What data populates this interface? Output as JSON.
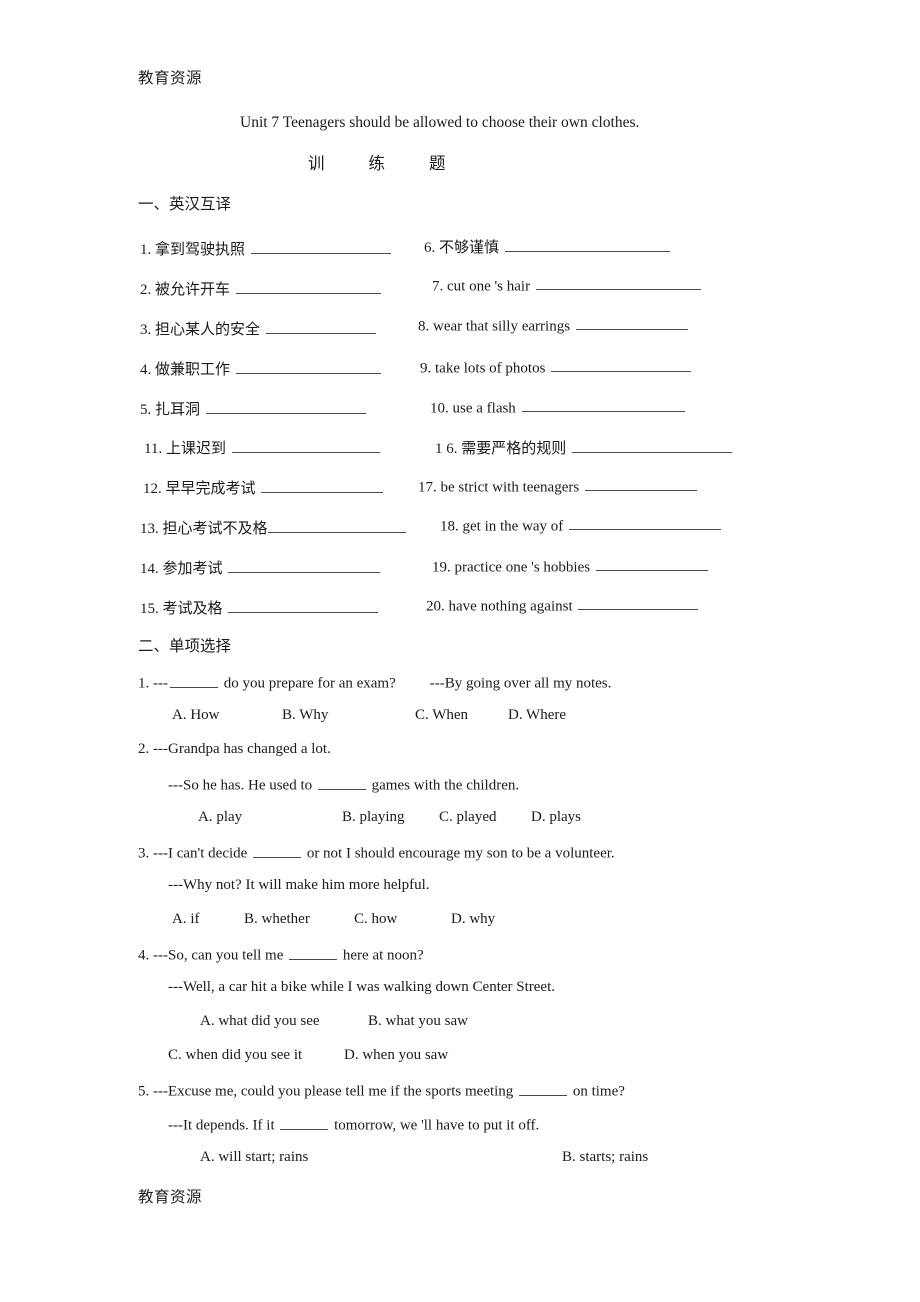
{
  "watermark": {
    "top": "教育资源",
    "bottom": "教育资源"
  },
  "title": {
    "main": "Unit 7 Teenagers should be allowed to choose their own clothes.",
    "sub": "训练题"
  },
  "sections": [
    {
      "heading": "一、英汉互译"
    },
    {
      "heading": "二、单项选择"
    }
  ],
  "translation": {
    "left": [
      {
        "num": "1.",
        "text": "拿到驾驶执照",
        "blank_width": 140,
        "gap": true
      },
      {
        "num": "2.",
        "text": "被允许开车",
        "blank_width": 145,
        "gap": true
      },
      {
        "num": "3.",
        "text": "担心某人的安全",
        "blank_width": 110,
        "gap": true
      },
      {
        "num": "4.",
        "text": "做兼职工作",
        "blank_width": 145,
        "gap": true
      },
      {
        "num": "5.",
        "text": "扎耳洞",
        "blank_width": 160,
        "gap": true
      },
      {
        "num": "11.",
        "text": "上课迟到",
        "blank_width": 148,
        "gap": true
      },
      {
        "num": "12.",
        "text": "早早完成考试",
        "blank_width": 122,
        "gap": true
      },
      {
        "num": "13.",
        "text": "担心考试不及格",
        "blank_width": 138,
        "gap": false
      },
      {
        "num": "14.",
        "text": "参加考试",
        "blank_width": 152,
        "gap": true
      },
      {
        "num": "15.",
        "text": "考试及格",
        "blank_width": 150,
        "gap": true
      }
    ],
    "right": [
      {
        "num": "6.",
        "text": "不够谨慎",
        "blank_width": 165,
        "gap": true
      },
      {
        "num": "7.",
        "text": "cut one 's hair",
        "blank_width": 165,
        "gap": true
      },
      {
        "num": "8.",
        "text": "wear that silly earrings",
        "blank_width": 112,
        "gap": true
      },
      {
        "num": "9.",
        "text": "take lots of photos",
        "blank_width": 140,
        "gap": true
      },
      {
        "num": "10.",
        "text": "use a flash",
        "blank_width": 163,
        "gap": true
      },
      {
        "num": "1 6.",
        "text": "需要严格的规则",
        "blank_width": 160,
        "gap": true
      },
      {
        "num": "17.",
        "text": "be strict with teenagers",
        "blank_width": 112,
        "gap": true
      },
      {
        "num": "18.",
        "text": "get in the way of",
        "blank_width": 152,
        "gap": true
      },
      {
        "num": "19.",
        "text": "practice one 's hobbies",
        "blank_width": 112,
        "gap": true
      },
      {
        "num": "20.",
        "text": "have nothing against",
        "blank_width": 120,
        "gap": true
      }
    ]
  },
  "multiple_choice": [
    {
      "num": "1.",
      "stem_prefix": "---",
      "stem_after": " do you prepare for an exam?",
      "reply": "---By going over all my notes.",
      "options_line1": [
        "A. How",
        "B. Why",
        "C. When",
        "D. Where"
      ]
    },
    {
      "num": "2.",
      "line1": "---Grandpa has changed a lot.",
      "line2_before": "---So he has. He used to ",
      "line2_after": " games with the children.",
      "options_line1": [
        "A. play",
        "B. playing",
        "C. played",
        "D. plays"
      ]
    },
    {
      "num": "3.",
      "line1_before": "---I can't decide ",
      "line1_after": " or not I should encourage my son to be a volunteer.",
      "line2": "---Why not? It will make him more helpful.",
      "options_line1": [
        "A. if",
        "B. whether",
        "C. how",
        "D. why"
      ]
    },
    {
      "num": "4.",
      "line1_before": "---So, can you tell me ",
      "line1_after": " here at noon?",
      "line2": "---Well, a car hit a bike while I was walking down Center Street.",
      "options_line1": [
        "A. what did you see",
        "B. what you saw"
      ],
      "options_line2": [
        "C. when did you see it",
        "D. when you saw"
      ]
    },
    {
      "num": "5.",
      "line1_before": "---Excuse me, could you please tell me if the sports meeting ",
      "line1_after": " on time?",
      "line2_before": "---It depends. If it ",
      "line2_after": " tomorrow, we 'll have to put it off.",
      "options_line1": [
        "A. will start; rains",
        "B. starts; rains"
      ]
    }
  ]
}
